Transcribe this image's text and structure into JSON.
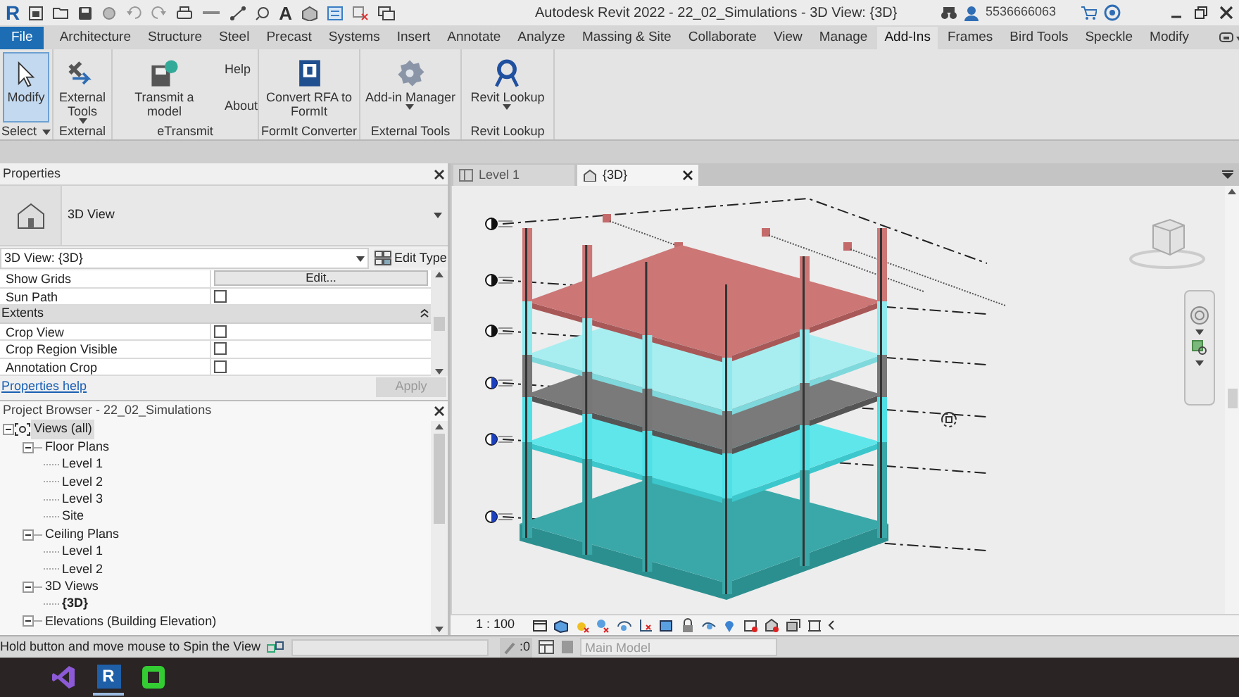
{
  "title_bar": {
    "logo": "R",
    "text_tool_glyph": "A",
    "title": "Autodesk Revit 2022 - 22_02_Simulations - 3D View: {3D}",
    "user_id": "5536666063"
  },
  "tabs": [
    {
      "label": "File",
      "kind": "file",
      "selected": false
    },
    {
      "label": "Architecture",
      "kind": "tab",
      "selected": false
    },
    {
      "label": "Structure",
      "kind": "tab",
      "selected": false
    },
    {
      "label": "Steel",
      "kind": "tab",
      "selected": false
    },
    {
      "label": "Precast",
      "kind": "tab",
      "selected": false
    },
    {
      "label": "Systems",
      "kind": "tab",
      "selected": false
    },
    {
      "label": "Insert",
      "kind": "tab",
      "selected": false
    },
    {
      "label": "Annotate",
      "kind": "tab",
      "selected": false
    },
    {
      "label": "Analyze",
      "kind": "tab",
      "selected": false
    },
    {
      "label": "Massing & Site",
      "kind": "tab",
      "selected": false
    },
    {
      "label": "Collaborate",
      "kind": "tab",
      "selected": false
    },
    {
      "label": "View",
      "kind": "tab",
      "selected": false
    },
    {
      "label": "Manage",
      "kind": "tab",
      "selected": false
    },
    {
      "label": "Add-Ins",
      "kind": "tab",
      "selected": true
    },
    {
      "label": "Frames",
      "kind": "tab",
      "selected": false
    },
    {
      "label": "Bird Tools",
      "kind": "tab",
      "selected": false
    },
    {
      "label": "Speckle",
      "kind": "tab",
      "selected": false
    },
    {
      "label": "Modify",
      "kind": "tab",
      "selected": false
    }
  ],
  "ribbon_panels": [
    {
      "label": "Select",
      "has_menu": true,
      "buttons": [
        {
          "label": "Modify",
          "kind": "large",
          "active": true
        }
      ]
    },
    {
      "label": "External",
      "buttons": [
        {
          "label": "External Tools",
          "kind": "large",
          "active": false,
          "has_menu": true
        }
      ]
    },
    {
      "label": "eTransmit",
      "buttons": [
        {
          "label": "Transmit a model",
          "kind": "large",
          "active": false
        },
        {
          "label": "Help",
          "kind": "small",
          "active": false
        },
        {
          "label": "About",
          "kind": "small",
          "active": false
        }
      ]
    },
    {
      "label": "FormIt Converter",
      "buttons": [
        {
          "label": "Convert RFA to FormIt",
          "kind": "large",
          "active": false
        }
      ]
    },
    {
      "label": "External Tools",
      "buttons": [
        {
          "label": "Add-in Manager",
          "kind": "large",
          "active": false,
          "has_menu": true
        }
      ]
    },
    {
      "label": "Revit Lookup",
      "buttons": [
        {
          "label": "Revit Lookup",
          "kind": "large",
          "active": false,
          "has_menu": true
        }
      ]
    }
  ],
  "properties": {
    "title": "Properties",
    "type_name": "3D View",
    "instance": "3D View: {3D}",
    "edit_type": "Edit Type",
    "rows": [
      {
        "kind": "button",
        "label": "Show Grids",
        "value": "Edit..."
      },
      {
        "kind": "check",
        "label": "Sun Path",
        "checked": false
      },
      {
        "kind": "group",
        "label": "Extents"
      },
      {
        "kind": "check",
        "label": "Crop View",
        "checked": false
      },
      {
        "kind": "check",
        "label": "Crop Region Visible",
        "checked": false
      },
      {
        "kind": "check",
        "label": "Annotation Crop",
        "checked": false
      }
    ],
    "help_link": "Properties help",
    "apply": "Apply",
    "apply_disabled": true
  },
  "browser": {
    "title": "Project Browser - 22_02_Simulations",
    "tree": [
      {
        "label": "Views (all)",
        "selected": true,
        "current": false,
        "expanded": true,
        "children": [
          {
            "label": "Floor Plans",
            "selected": false,
            "current": false,
            "expanded": true,
            "children": [
              {
                "label": "Level 1",
                "selected": false,
                "current": false
              },
              {
                "label": "Level 2",
                "selected": false,
                "current": false
              },
              {
                "label": "Level 3",
                "selected": false,
                "current": false
              },
              {
                "label": "Site",
                "selected": false,
                "current": false
              }
            ]
          },
          {
            "label": "Ceiling Plans",
            "selected": false,
            "current": false,
            "expanded": true,
            "children": [
              {
                "label": "Level 1",
                "selected": false,
                "current": false
              },
              {
                "label": "Level 2",
                "selected": false,
                "current": false
              }
            ]
          },
          {
            "label": "3D Views",
            "selected": false,
            "current": false,
            "expanded": true,
            "children": [
              {
                "label": "{3D}",
                "selected": false,
                "current": true
              }
            ]
          },
          {
            "label": "Elevations (Building Elevation)",
            "selected": false,
            "current": false,
            "expanded": true
          }
        ]
      }
    ]
  },
  "view_tabs": [
    {
      "label": "Level 1",
      "selected": false
    },
    {
      "label": "{3D}",
      "selected": true
    }
  ],
  "view_controls": {
    "scale": "1 : 100"
  },
  "status_bar": {
    "hint": "Hold button and move mouse to Spin the View",
    "workset": ":0",
    "design_option": "Main Model",
    "design_option_disabled": true
  },
  "taskbar": {
    "revit_glyph": "R"
  }
}
